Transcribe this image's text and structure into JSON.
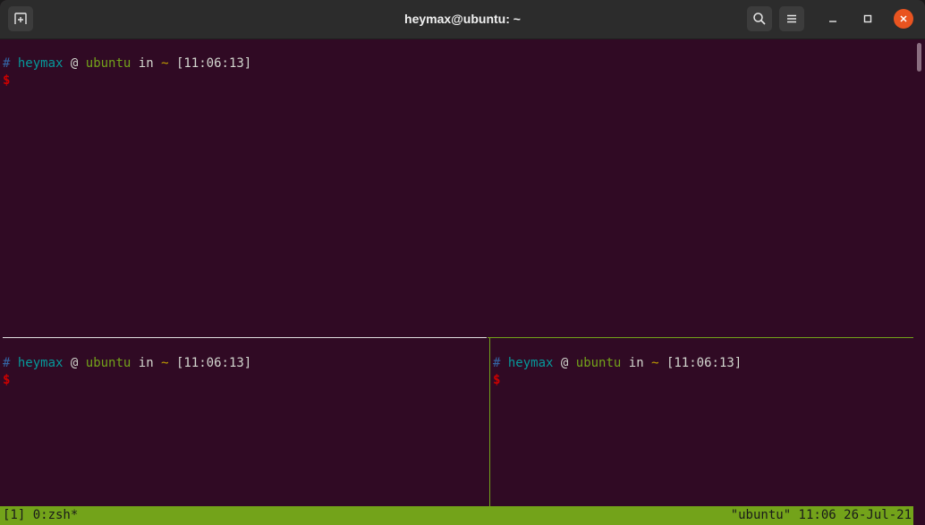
{
  "window": {
    "title": "heymax@ubuntu: ~"
  },
  "icons": {
    "new_tab": "new-tab-icon",
    "search": "search-icon",
    "menu": "hamburger-menu-icon",
    "minimize": "minimize-icon",
    "maximize": "maximize-icon",
    "close": "close-icon"
  },
  "colors": {
    "terminal_bg": "#300a24",
    "titlebar_bg": "#2c2c2c",
    "status_bar_bg": "#73a31a",
    "close_button": "#e95420",
    "prompt_hash": "#3465a4",
    "prompt_user": "#06989a",
    "prompt_host": "#73a31a",
    "prompt_dir": "#c4a000",
    "prompt_dollar": "#cc0000"
  },
  "prompt": {
    "hash": "#",
    "user": "heymax",
    "at": "@",
    "host": "ubuntu",
    "in": "in",
    "dir": "~",
    "time": "[11:06:13]",
    "dollar": "$"
  },
  "status_bar": {
    "left": "[1] 0:zsh*",
    "right": "\"ubuntu\" 11:06 26-Jul-21"
  }
}
